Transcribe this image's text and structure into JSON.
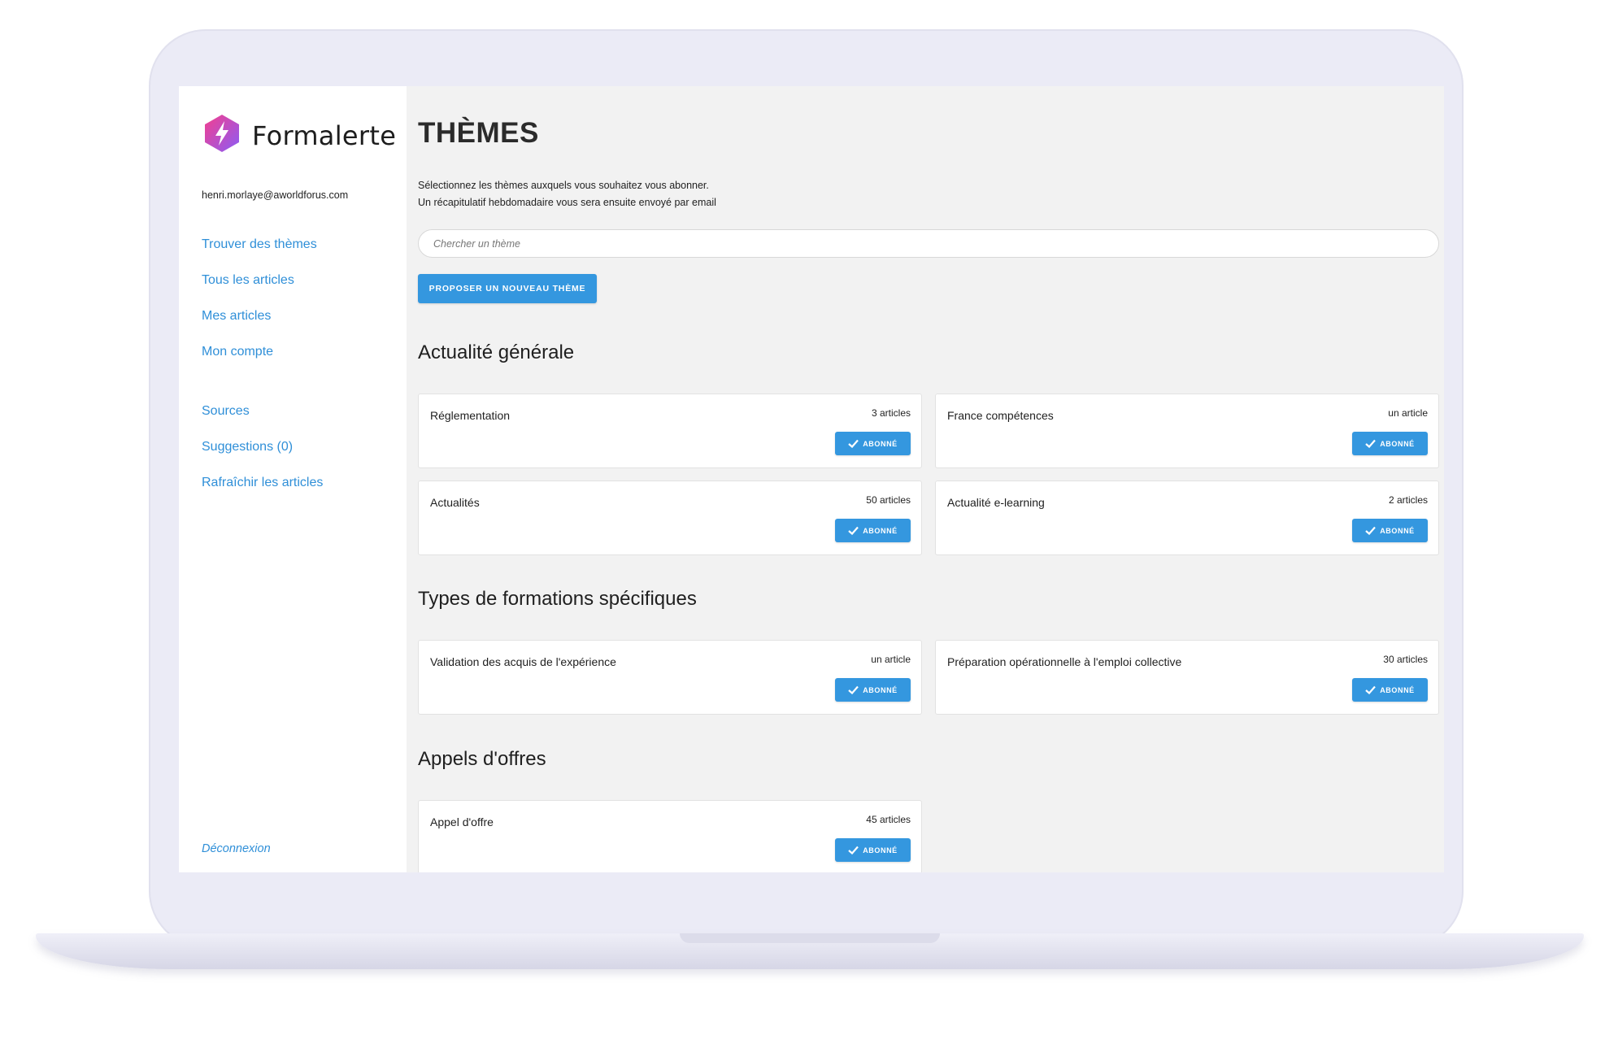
{
  "app": {
    "name": "Formalerte",
    "brand_color": "#a855f7"
  },
  "sidebar": {
    "user_email": "henri.morlaye@aworldforus.com",
    "nav_primary": [
      {
        "label": "Trouver des thèmes"
      },
      {
        "label": "Tous les articles"
      },
      {
        "label": "Mes articles"
      },
      {
        "label": "Mon compte"
      }
    ],
    "nav_secondary": [
      {
        "label": "Sources"
      },
      {
        "label": "Suggestions (0)"
      },
      {
        "label": "Rafraîchir les articles"
      }
    ],
    "logout_label": "Déconnexion",
    "link_color": "#2f8fd8"
  },
  "main": {
    "title": "THÈMES",
    "intro_line1": "Sélectionnez les thèmes auxquels vous souhaitez vous abonner.",
    "intro_line2": "Un récapitulatif hebdomadaire vous sera ensuite envoyé par email",
    "search_placeholder": "Chercher un thème",
    "propose_button": "PROPOSER UN NOUVEAU THÈME",
    "accent_color": "#3497df",
    "sections": [
      {
        "title": "Actualité générale",
        "cards": [
          {
            "name": "Réglementation",
            "count": "3 articles",
            "button": "ABONNÉ"
          },
          {
            "name": "France compétences",
            "count": "un article",
            "button": "ABONNÉ"
          },
          {
            "name": "Actualités",
            "count": "50 articles",
            "button": "ABONNÉ"
          },
          {
            "name": "Actualité e-learning",
            "count": "2 articles",
            "button": "ABONNÉ"
          }
        ]
      },
      {
        "title": "Types de formations spécifiques",
        "cards": [
          {
            "name": "Validation des acquis de l'expérience",
            "count": "un article",
            "button": "ABONNÉ"
          },
          {
            "name": "Préparation opérationnelle à l'emploi collective",
            "count": "30 articles",
            "button": "ABONNÉ"
          }
        ]
      },
      {
        "title": "Appels d'offres",
        "cards": [
          {
            "name": "Appel d'offre",
            "count": "45 articles",
            "button": "ABONNÉ"
          }
        ]
      }
    ]
  }
}
